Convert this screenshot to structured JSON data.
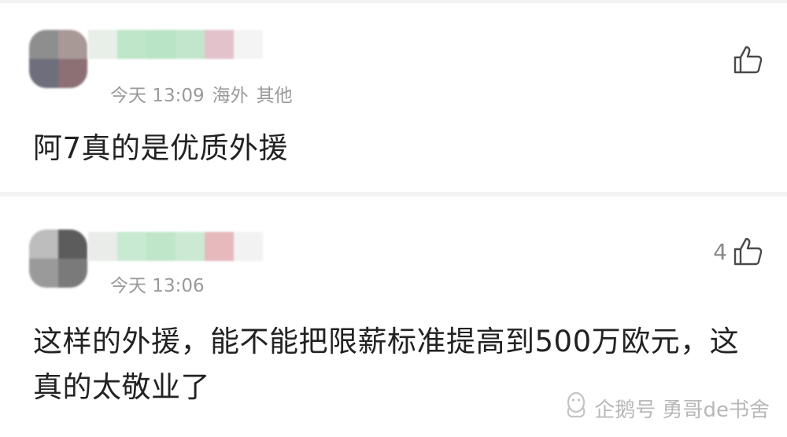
{
  "comments": [
    {
      "time": "今天 13:09",
      "location": "海外",
      "device": "其他",
      "text": "阿7真的是优质外援",
      "like_count": "",
      "avatar_tiles": [
        "#8e8e8e",
        "#a89896",
        "#6e6e7c",
        "#8c7074"
      ],
      "name_tiles": [
        "#e8efe9",
        "#bfe6c9",
        "#b9e4c6",
        "#c2e6cc",
        "#e4c2cc",
        "#f4f4f4"
      ]
    },
    {
      "time": "今天 13:06",
      "location": "",
      "device": "",
      "text": "这样的外援，能不能把限薪标准提高到500万欧元，这真的太敬业了",
      "like_count": "4",
      "avatar_tiles": [
        "#bdbdbd",
        "#5c5c5c",
        "#9a9a9a",
        "#7a7a7a"
      ],
      "name_tiles": [
        "#e9ece9",
        "#c8e9d2",
        "#bfe6c9",
        "#cbe9d3",
        "#e6b9bc",
        "#f2f2f2"
      ]
    }
  ],
  "watermark": {
    "text": "企鹅号 勇哥de书舍",
    "icon": "penguin-logo-icon"
  }
}
